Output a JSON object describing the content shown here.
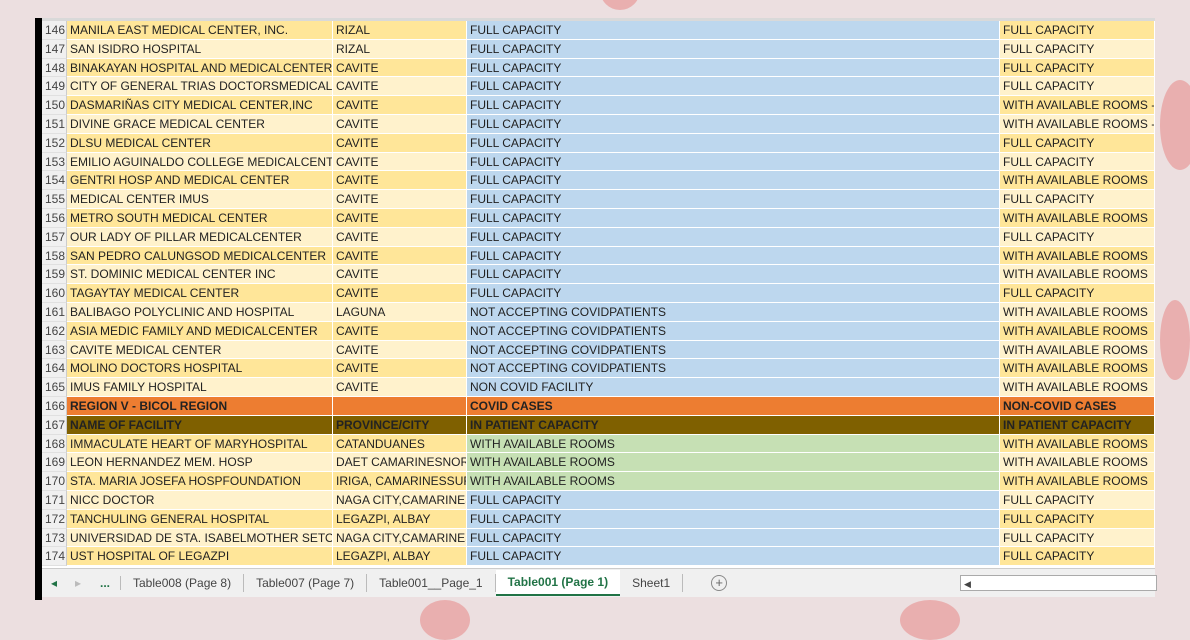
{
  "rows": [
    {
      "n": "146",
      "a": "MANILA EAST MEDICAL CENTER, INC.",
      "b": "RIZAL",
      "c": "FULL CAPACITY",
      "d": "FULL CAPACITY"
    },
    {
      "n": "147",
      "a": "SAN ISIDRO HOSPITAL",
      "b": "RIZAL",
      "c": "FULL CAPACITY",
      "d": "FULL CAPACITY"
    },
    {
      "n": "148",
      "a": "BINAKAYAN HOSPITAL AND MEDICALCENTER",
      "b": "CAVITE",
      "c": "FULL CAPACITY",
      "d": "FULL CAPACITY"
    },
    {
      "n": "149",
      "a": "CITY OF GENERAL TRIAS DOCTORSMEDICAL CENTER",
      "b": "CAVITE",
      "c": "FULL CAPACITY",
      "d": "FULL CAPACITY"
    },
    {
      "n": "150",
      "a": "DASMARIÑAS CITY MEDICAL CENTER,INC",
      "b": "CAVITE",
      "c": "FULL CAPACITY",
      "d": "WITH AVAILABLE ROOMS -"
    },
    {
      "n": "151",
      "a": "DIVINE GRACE MEDICAL CENTER",
      "b": "CAVITE",
      "c": "FULL CAPACITY",
      "d": "WITH AVAILABLE ROOMS -"
    },
    {
      "n": "152",
      "a": "DLSU MEDICAL CENTER",
      "b": "CAVITE",
      "c": "FULL CAPACITY",
      "d": "FULL CAPACITY"
    },
    {
      "n": "153",
      "a": "EMILIO AGUINALDO COLLEGE MEDICALCENTER",
      "b": "CAVITE",
      "c": "FULL CAPACITY",
      "d": "FULL CAPACITY"
    },
    {
      "n": "154",
      "a": "GENTRI HOSP AND MEDICAL CENTER",
      "b": "CAVITE",
      "c": "FULL CAPACITY",
      "d": "WITH AVAILABLE ROOMS"
    },
    {
      "n": "155",
      "a": "MEDICAL CENTER IMUS",
      "b": "CAVITE",
      "c": "FULL CAPACITY",
      "d": "FULL CAPACITY"
    },
    {
      "n": "156",
      "a": "METRO SOUTH MEDICAL CENTER",
      "b": "CAVITE",
      "c": "FULL CAPACITY",
      "d": "WITH AVAILABLE ROOMS"
    },
    {
      "n": "157",
      "a": "OUR LADY OF PILLAR MEDICALCENTER",
      "b": "CAVITE",
      "c": "FULL CAPACITY",
      "d": "FULL CAPACITY"
    },
    {
      "n": "158",
      "a": "SAN PEDRO CALUNGSOD MEDICALCENTER",
      "b": "CAVITE",
      "c": "FULL CAPACITY",
      "d": "WITH AVAILABLE ROOMS"
    },
    {
      "n": "159",
      "a": "ST. DOMINIC MEDICAL CENTER INC",
      "b": "CAVITE",
      "c": "FULL CAPACITY",
      "d": "WITH AVAILABLE ROOMS"
    },
    {
      "n": "160",
      "a": "TAGAYTAY MEDICAL CENTER",
      "b": "CAVITE",
      "c": "FULL CAPACITY",
      "d": "FULL CAPACITY"
    },
    {
      "n": "161",
      "a": "BALIBAGO POLYCLINIC AND HOSPITAL",
      "b": "LAGUNA",
      "c": "NOT ACCEPTING COVIDPATIENTS",
      "d": "WITH AVAILABLE ROOMS"
    },
    {
      "n": "162",
      "a": "ASIA MEDIC FAMILY AND MEDICALCENTER",
      "b": "CAVITE",
      "c": "NOT ACCEPTING COVIDPATIENTS",
      "d": "WITH AVAILABLE ROOMS"
    },
    {
      "n": "163",
      "a": "CAVITE MEDICAL CENTER",
      "b": "CAVITE",
      "c": "NOT ACCEPTING COVIDPATIENTS",
      "d": "WITH AVAILABLE ROOMS"
    },
    {
      "n": "164",
      "a": "MOLINO DOCTORS HOSPITAL",
      "b": "CAVITE",
      "c": "NOT ACCEPTING COVIDPATIENTS",
      "d": "WITH AVAILABLE ROOMS"
    },
    {
      "n": "165",
      "a": "IMUS FAMILY HOSPITAL",
      "b": "CAVITE",
      "c": "NON COVID FACILITY",
      "d": "WITH AVAILABLE ROOMS"
    },
    {
      "n": "166",
      "a": "REGION V - BICOL REGION",
      "b": "",
      "c": "COVID CASES",
      "d": "NON-COVID CASES",
      "type": "region"
    },
    {
      "n": "167",
      "a": "NAME OF FACILITY",
      "b": "PROVINCE/CITY",
      "c": "IN PATIENT CAPACITY",
      "d": "IN PATIENT CAPACITY",
      "type": "head"
    },
    {
      "n": "168",
      "a": "IMMACULATE HEART OF MARYHOSPITAL",
      "b": "CATANDUANES",
      "c": "WITH AVAILABLE ROOMS",
      "d": "WITH AVAILABLE ROOMS",
      "type": "green"
    },
    {
      "n": "169",
      "a": "LEON HERNANDEZ MEM. HOSP",
      "b": "DAET CAMARINESNORTE",
      "c": "WITH AVAILABLE ROOMS",
      "d": "WITH AVAILABLE ROOMS",
      "type": "green"
    },
    {
      "n": "170",
      "a": "STA. MARIA JOSEFA HOSPFOUNDATION",
      "b": "IRIGA, CAMARINESSUR",
      "c": "WITH AVAILABLE ROOMS",
      "d": "WITH AVAILABLE ROOMS",
      "type": "green"
    },
    {
      "n": "171",
      "a": "NICC DOCTOR",
      "b": "NAGA CITY,CAMARINES SUR",
      "c": "FULL CAPACITY",
      "d": "FULL CAPACITY"
    },
    {
      "n": "172",
      "a": "TANCHULING GENERAL HOSPITAL",
      "b": "LEGAZPI, ALBAY",
      "c": "FULL CAPACITY",
      "d": "FULL CAPACITY"
    },
    {
      "n": "173",
      "a": "UNIVERSIDAD DE STA. ISABELMOTHER SETON HOSPITAL",
      "b": "NAGA CITY,CAMARINES SUR",
      "c": "FULL CAPACITY",
      "d": "FULL CAPACITY"
    },
    {
      "n": "174",
      "a": "UST HOSPITAL OF LEGAZPI",
      "b": "LEGAZPI, ALBAY",
      "c": "FULL CAPACITY",
      "d": "FULL CAPACITY"
    }
  ],
  "tabs": {
    "more": "...",
    "items": [
      "Table008 (Page 8)",
      "Table007 (Page 7)",
      "Table001__Page_1",
      "Table001 (Page 1)",
      "Sheet1"
    ],
    "active": 3,
    "add": "+"
  }
}
